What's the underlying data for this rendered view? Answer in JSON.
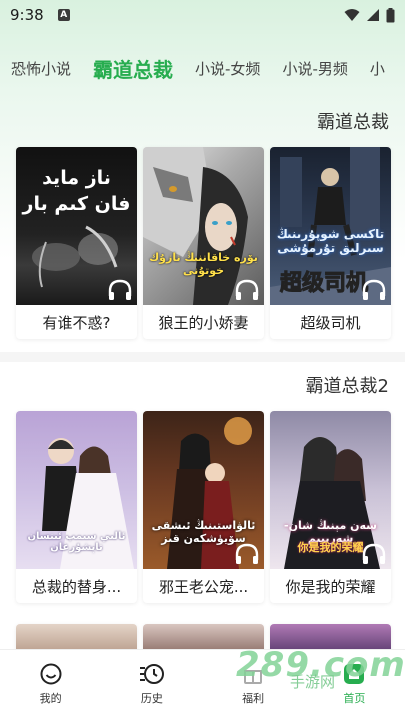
{
  "status": {
    "time": "9:38",
    "notif": "A"
  },
  "tabs": [
    {
      "label": "恐怖小说"
    },
    {
      "label": "霸道总裁"
    },
    {
      "label": "小说-女频"
    },
    {
      "label": "小说-男频"
    },
    {
      "label": "小"
    }
  ],
  "active_tab": 1,
  "sections": [
    {
      "title": "霸道总裁",
      "books": [
        {
          "title": "有谁不惑?",
          "cover_text": "ناز مايد ڧان كىم بار"
        },
        {
          "title": "狼王的小娇妻",
          "cover_text": "بۆرە خاقاننىڭ نازۇك خوتۇنى"
        },
        {
          "title": "超级司机",
          "cover_text": "تاكسى شوپۇرىنىڭ سىرلىق تۇرمۇشى",
          "cover_badge": "超级司机"
        }
      ]
    },
    {
      "title": "霸道总裁2",
      "books": [
        {
          "title": "总裁的替身...",
          "cover_text": "ئالىي سىمپ ئىنسان تاپشۇرغان"
        },
        {
          "title": "邪王老公宠...",
          "cover_text": "ئالۋاستىنىڭ ئىشقى سۆيۈشكەن قىز"
        },
        {
          "title": "你是我的荣耀",
          "cover_text": "سەن مېنىڭ شان-شەرىپىم",
          "cover_badge": "你是我的荣耀"
        }
      ]
    }
  ],
  "nav": [
    {
      "label": "我的",
      "icon": "smile-icon"
    },
    {
      "label": "历史",
      "icon": "history-icon"
    },
    {
      "label": "福利",
      "icon": "gift-icon"
    },
    {
      "label": "首页",
      "icon": "home-icon"
    }
  ],
  "watermark": {
    "main": "289.com",
    "sub": "手游网"
  },
  "colors": {
    "accent": "#27ad4f"
  }
}
